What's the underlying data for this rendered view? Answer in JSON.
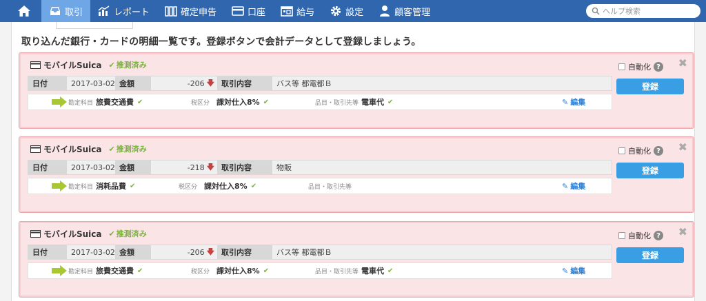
{
  "nav": {
    "items": [
      {
        "label": "取引",
        "icon": "inbox-icon",
        "active": true
      },
      {
        "label": "レポート",
        "icon": "chart-icon"
      },
      {
        "label": "確定申告",
        "icon": "books-icon"
      },
      {
        "label": "口座",
        "icon": "bank-card-icon"
      },
      {
        "label": "給与",
        "icon": "calendar-icon"
      },
      {
        "label": "設定",
        "icon": "gear-icon"
      },
      {
        "label": "顧客管理",
        "icon": "person-icon"
      }
    ],
    "search_placeholder": "ヘルプ検索"
  },
  "heading": "取り込んだ銀行・カードの明細一覧です。登録ボタンで会計データとして登録しましょう。",
  "labels": {
    "estimated": "推測済み",
    "date": "日付",
    "amount": "金額",
    "description": "取引内容",
    "account_item": "勘定科目",
    "tax_class": "税区分",
    "item_partner": "品目・取引先等",
    "edit": "編集",
    "auto": "自動化",
    "register": "登録",
    "help": "?",
    "close": "✖",
    "down_arrow": "🡇"
  },
  "transactions": [
    {
      "account": "モバイルSuica",
      "date": "2017-03-02",
      "amount": "-206",
      "description": "バス等 都電都Ｂ",
      "category": "旅費交通費",
      "tax": "課対仕入8%",
      "partner": "電車代"
    },
    {
      "account": "モバイルSuica",
      "date": "2017-03-02",
      "amount": "-218",
      "description": "物販",
      "category": "消耗品費",
      "tax": "課対仕入8%",
      "partner": ""
    },
    {
      "account": "モバイルSuica",
      "date": "2017-03-02",
      "amount": "-206",
      "description": "バス等 都電都Ｂ",
      "category": "旅費交通費",
      "tax": "課対仕入8%",
      "partner": "電車代"
    }
  ],
  "colors": {
    "nav_bg": "#2f66ad",
    "nav_active": "#6fa7e6",
    "card_bg": "#fbe4e6",
    "check_green": "#7ab43c",
    "register_blue": "#3a9ee4"
  }
}
